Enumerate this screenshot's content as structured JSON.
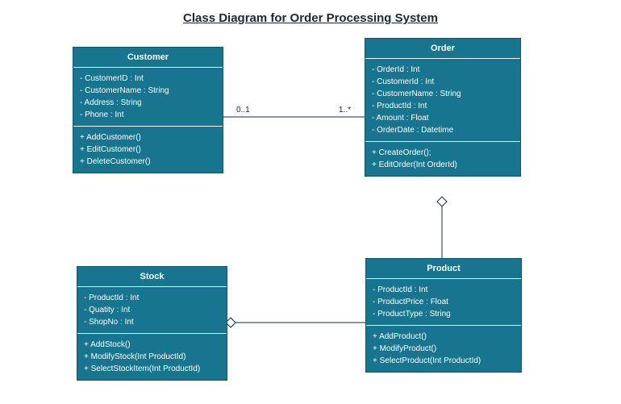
{
  "title": "Class Diagram for Order Processing System",
  "classes": {
    "customer": {
      "name": "Customer",
      "attrs": [
        "- CustomerID : Int",
        "- CustomerName : String",
        "- Address : String",
        "- Phone : Int"
      ],
      "ops": [
        "+ AddCustomer()",
        "+ EditCustomer()",
        "+ DeleteCustomer()"
      ]
    },
    "order": {
      "name": "Order",
      "attrs": [
        "- OrderId : Int",
        "- CustomerId : Int",
        "- CustomerName : String",
        "- ProductId : Int",
        "- Amount : Float",
        "- OrderDate : Datetime"
      ],
      "ops": [
        "+ CreateOrder();",
        "+ EditOrder(Int OrderId)"
      ]
    },
    "stock": {
      "name": "Stock",
      "attrs": [
        "- ProductId : Int",
        "- Quatity : Int",
        "- ShopNo : Int"
      ],
      "ops": [
        "+ AddStock()",
        "+ ModifyStock(Int ProductId)",
        "+ SelectStockItem(Int ProductId)"
      ]
    },
    "product": {
      "name": "Product",
      "attrs": [
        "- ProductId : Int",
        "- ProductPrice : Float",
        "- ProductType : String"
      ],
      "ops": [
        "+ AddProduct()",
        "+ ModifyProduct()",
        "+ SelectProduct(Int ProductId)"
      ]
    }
  },
  "multiplicities": {
    "cust_side": "0..1",
    "order_side": "1..*"
  }
}
